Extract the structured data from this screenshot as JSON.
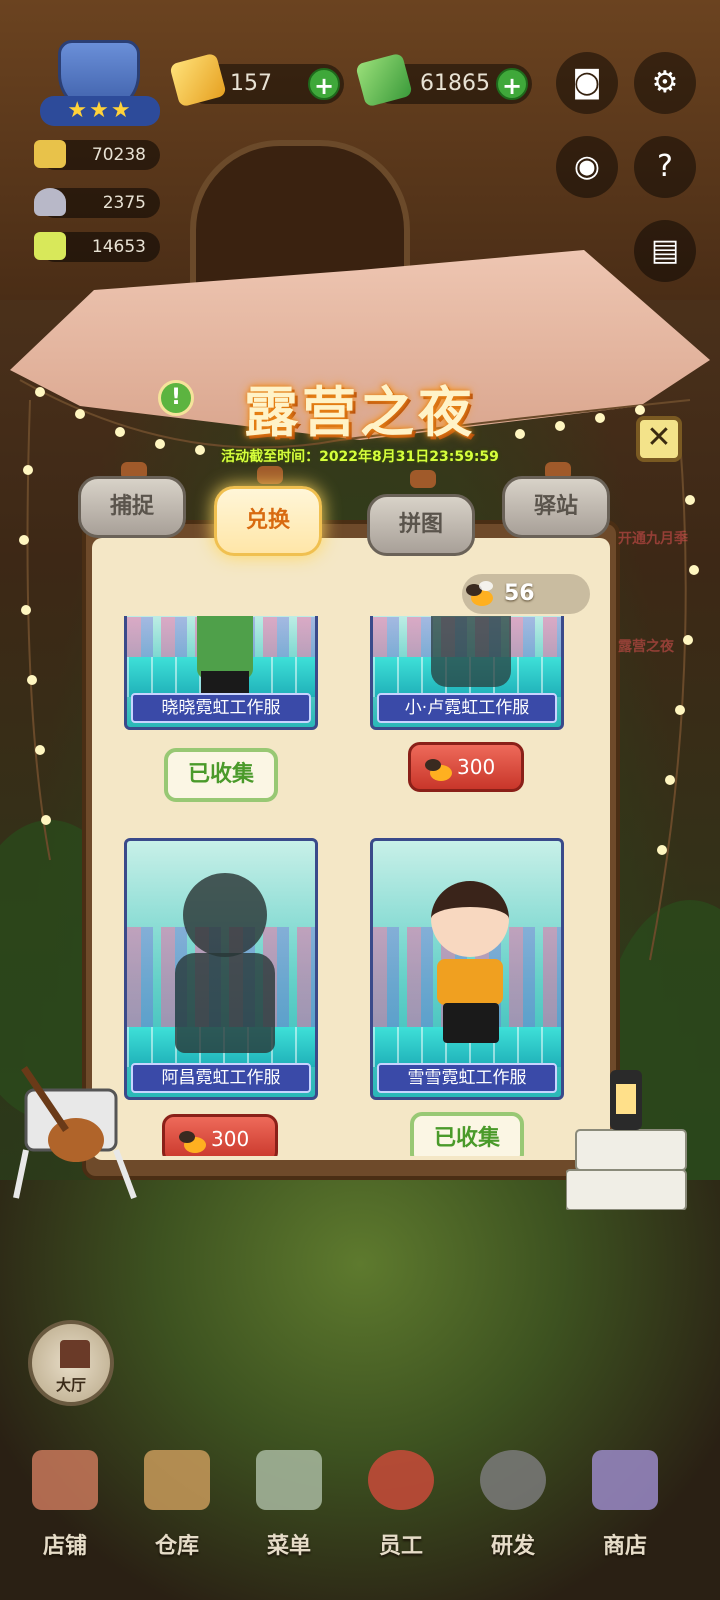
{
  "hud": {
    "rating_stars": "★★★",
    "currency_gold": "157",
    "currency_cash": "61865",
    "stats": [
      "70238",
      "2375",
      "14653"
    ],
    "plus_label": "+"
  },
  "event": {
    "title": "露营之夜",
    "deadline": "活动截至时间：2022年8月31日23:59:59",
    "info_label": "!",
    "close_label": "✕"
  },
  "tabs": [
    {
      "label": "捕捉",
      "active": false
    },
    {
      "label": "兑换",
      "active": true
    },
    {
      "label": "拼图",
      "active": false
    },
    {
      "label": "驿站",
      "active": false
    }
  ],
  "firefly_balance": "56",
  "items": [
    {
      "name": "晓晓霓虹工作服",
      "status": "已收集"
    },
    {
      "name": "小·卢霓虹工作服",
      "price": "300"
    },
    {
      "name": "阿昌霓虹工作服",
      "price": "300"
    },
    {
      "name": "雪雪霓虹工作服",
      "status": "已收集"
    }
  ],
  "hall_label": "大厅",
  "nav": [
    "店铺",
    "仓库",
    "菜单",
    "员工",
    "研发",
    "商店"
  ],
  "side_labels": [
    "开通九月季",
    "露营之夜"
  ],
  "colors": {
    "active_tab_text": "#d86a10",
    "price_button": "#c8362a",
    "collected_border": "#98c874",
    "deadline_text": "#d6ff3c"
  }
}
